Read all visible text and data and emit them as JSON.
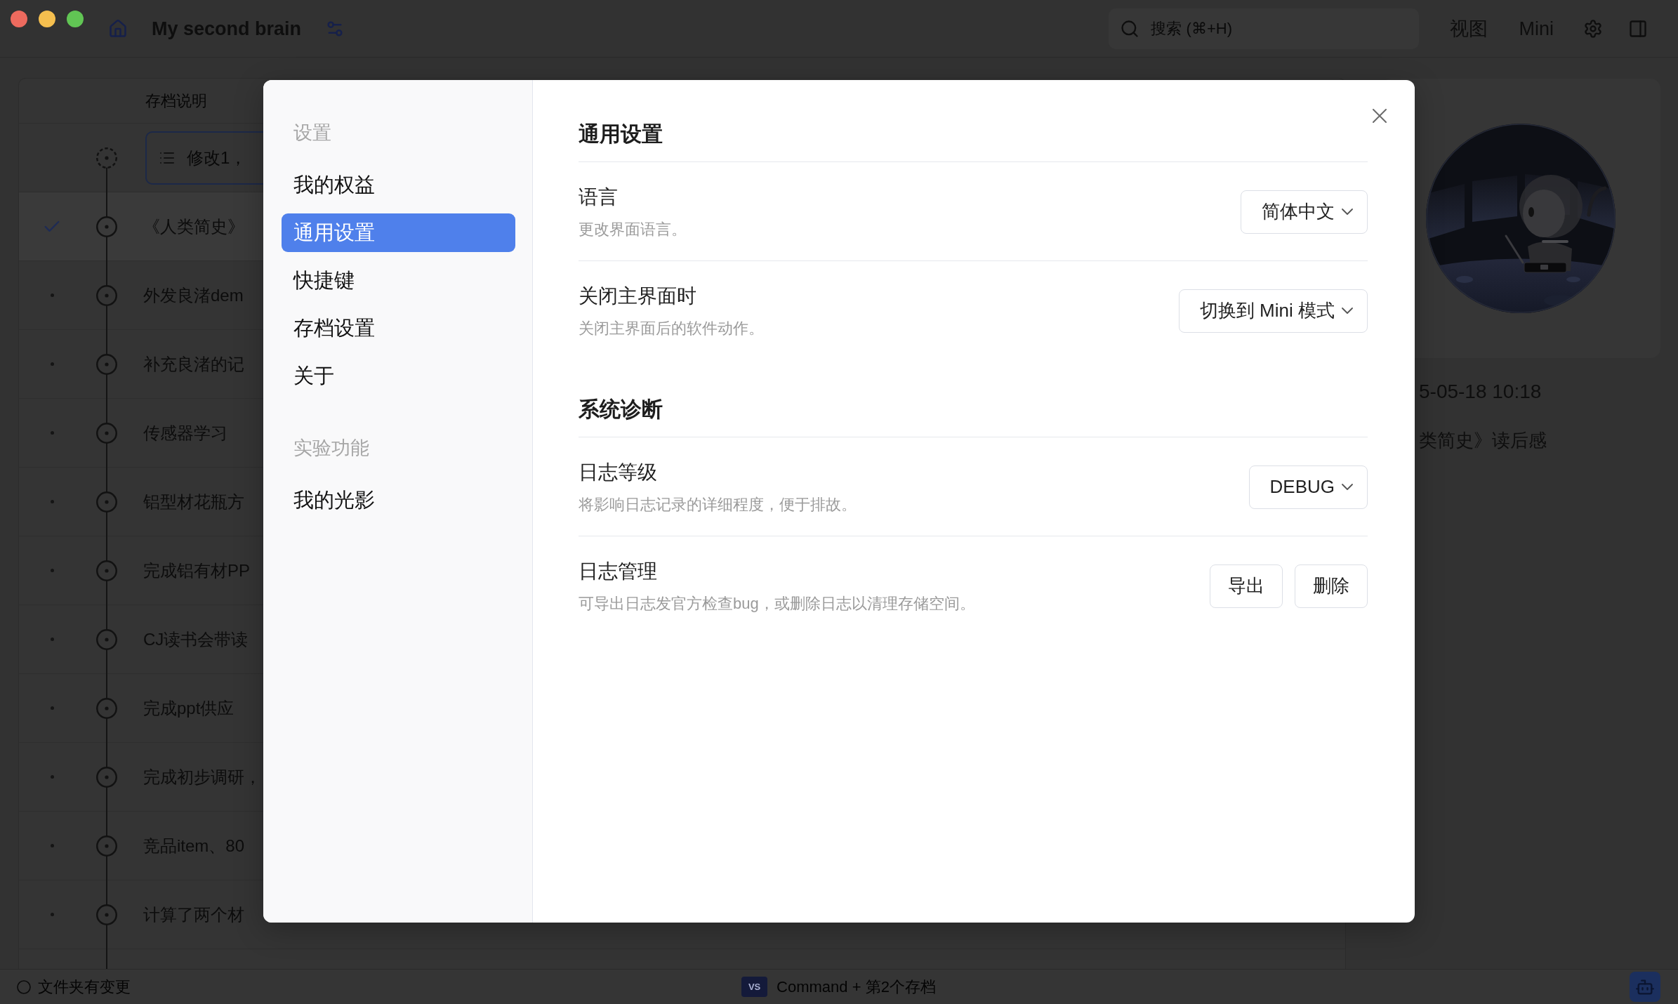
{
  "window": {
    "title": "My second brain"
  },
  "toolbar": {
    "search": {
      "placeholder": "搜索 (⌘+H)"
    },
    "buttons": [
      {
        "label": "视图"
      },
      {
        "label": "Mini"
      }
    ]
  },
  "archive_list": {
    "column_header": "存档说明",
    "new_entry": {
      "placeholder": "修改1，"
    },
    "rows": [
      {
        "text": "《人类简史》",
        "selected": true
      },
      {
        "text": "外发良渚dem",
        "selected": false
      },
      {
        "text": "补充良渚的记",
        "selected": false
      },
      {
        "text": "传感器学习",
        "selected": false
      },
      {
        "text": "铝型材花瓶方",
        "selected": false
      },
      {
        "text": "完成铝有材PP",
        "selected": false
      },
      {
        "text": "CJ读书会带读",
        "selected": false
      },
      {
        "text": "完成ppt供应",
        "selected": false
      },
      {
        "text": "完成初步调研，",
        "selected": false
      },
      {
        "text": "竞品item、80",
        "selected": false
      },
      {
        "text": "计算了两个材",
        "selected": false
      }
    ]
  },
  "preview": {
    "timestamp": "5-05-18 10:18",
    "title": "类简史》读后感"
  },
  "status_bar": {
    "folder_status": "文件夹有变更",
    "badge": "VS",
    "current_archive": "Command + 第2个存档"
  },
  "settings_dialog": {
    "nav_groups": [
      {
        "heading": "设置",
        "items": [
          {
            "label": "我的权益",
            "selected": false
          },
          {
            "label": "通用设置",
            "selected": true
          },
          {
            "label": "快捷键",
            "selected": false
          },
          {
            "label": "存档设置",
            "selected": false
          },
          {
            "label": "关于",
            "selected": false
          }
        ]
      },
      {
        "heading": "实验功能",
        "items": [
          {
            "label": "我的光影",
            "selected": false
          }
        ]
      }
    ],
    "sections": [
      {
        "title": "通用设置",
        "rows": [
          {
            "title": "语言",
            "description": "更改界面语言。",
            "controls": [
              {
                "kind": "dropdown",
                "value": "简体中文"
              }
            ]
          },
          {
            "title": "关闭主界面时",
            "description": "关闭主界面后的软件动作。",
            "controls": [
              {
                "kind": "dropdown",
                "value": "切换到 Mini 模式"
              }
            ]
          }
        ]
      },
      {
        "title": "系统诊断",
        "rows": [
          {
            "title": "日志等级",
            "description": "将影响日志记录的详细程度，便于排故。",
            "controls": [
              {
                "kind": "dropdown",
                "value": "DEBUG"
              }
            ]
          },
          {
            "title": "日志管理",
            "description": "可导出日志发官方检查bug，或删除日志以清理存储空间。",
            "controls": [
              {
                "kind": "button",
                "label": "导出"
              },
              {
                "kind": "button",
                "label": "删除"
              }
            ]
          }
        ]
      }
    ]
  }
}
